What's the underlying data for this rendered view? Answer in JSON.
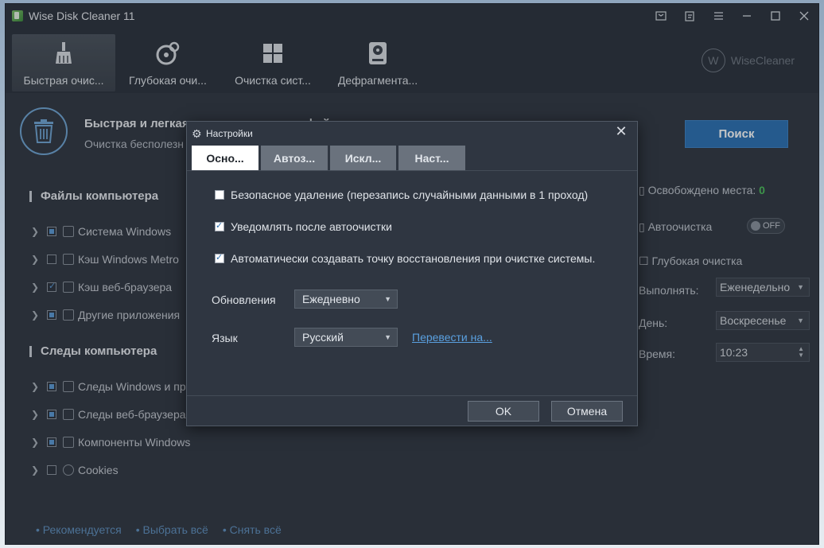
{
  "window": {
    "title": "Wise Disk Cleaner 11"
  },
  "toolbar": {
    "items": [
      {
        "label": "Быстрая очис...",
        "icon": "broom-icon"
      },
      {
        "label": "Глубокая очи...",
        "icon": "deep-clean-icon"
      },
      {
        "label": "Очистка сист...",
        "icon": "windows-icon"
      },
      {
        "label": "Дефрагмента...",
        "icon": "disk-icon"
      }
    ],
    "brand": "WiseCleaner",
    "brand_logo": "W"
  },
  "header": {
    "title": "Быстрая и легкая очистка ненужных файлов и истории",
    "subtitle": "Очистка бесполезн",
    "scan_label": "Поиск"
  },
  "sections": {
    "computer_files": "Файлы компьютера",
    "computer_traces": "Следы компьютера"
  },
  "file_items": [
    {
      "label": "Система Windows",
      "state": "partial"
    },
    {
      "label": "Кэш Windows Metro",
      "state": "unchecked"
    },
    {
      "label": "Кэш веб-браузера",
      "state": "checked"
    },
    {
      "label": "Другие приложения",
      "state": "partial"
    }
  ],
  "trace_items": [
    {
      "label": "Следы Windows и пр",
      "state": "partial"
    },
    {
      "label": "Следы веб-браузера",
      "state": "partial"
    },
    {
      "label": "Компоненты Windows",
      "state": "partial"
    },
    {
      "label": "Cookies",
      "state": "unchecked"
    }
  ],
  "right_panel": {
    "freed_label": "Освобождено места:",
    "freed_value": "0",
    "autoclean_label": "Автоочистка",
    "toggle_label": "OFF",
    "deep_clean_label": "Глубокая очистка",
    "run_label": "Выполнять:",
    "run_value": "Еженедельно",
    "day_label": "День:",
    "day_value": "Воскресенье",
    "time_label": "Время:",
    "time_value": "10:23"
  },
  "footer": {
    "recommended": "Рекомендуется",
    "select_all": "Выбрать всё",
    "deselect_all": "Снять всё"
  },
  "dialog": {
    "title": "Настройки",
    "tabs": [
      {
        "label": "Осно...",
        "active": true
      },
      {
        "label": "Автоз...",
        "active": false
      },
      {
        "label": "Искл...",
        "active": false
      },
      {
        "label": "Наст...",
        "active": false
      }
    ],
    "options": [
      {
        "label": "Безопасное удаление (перезапись случайными данными в 1 проход)",
        "checked": false
      },
      {
        "label": "Уведомлять после автоочистки",
        "checked": true
      },
      {
        "label": "Автоматически создавать точку восстановления при очистке системы.",
        "checked": true
      }
    ],
    "updates_label": "Обновления",
    "updates_value": "Ежедневно",
    "language_label": "Язык",
    "language_value": "Русский",
    "translate_link": "Перевести на...",
    "ok_label": "OK",
    "cancel_label": "Отмена"
  }
}
